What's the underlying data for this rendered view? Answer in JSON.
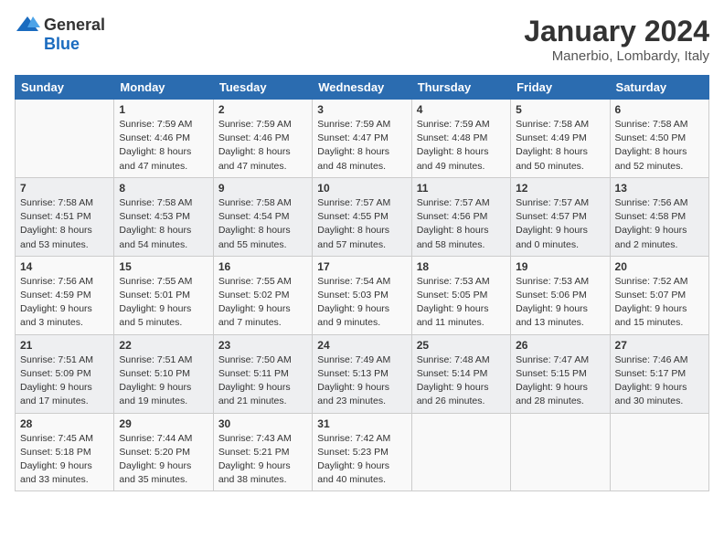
{
  "header": {
    "logo_general": "General",
    "logo_blue": "Blue",
    "title": "January 2024",
    "subtitle": "Manerbio, Lombardy, Italy"
  },
  "days_of_week": [
    "Sunday",
    "Monday",
    "Tuesday",
    "Wednesday",
    "Thursday",
    "Friday",
    "Saturday"
  ],
  "weeks": [
    [
      {
        "day": "",
        "lines": []
      },
      {
        "day": "1",
        "lines": [
          "Sunrise: 7:59 AM",
          "Sunset: 4:46 PM",
          "Daylight: 8 hours",
          "and 47 minutes."
        ]
      },
      {
        "day": "2",
        "lines": [
          "Sunrise: 7:59 AM",
          "Sunset: 4:46 PM",
          "Daylight: 8 hours",
          "and 47 minutes."
        ]
      },
      {
        "day": "3",
        "lines": [
          "Sunrise: 7:59 AM",
          "Sunset: 4:47 PM",
          "Daylight: 8 hours",
          "and 48 minutes."
        ]
      },
      {
        "day": "4",
        "lines": [
          "Sunrise: 7:59 AM",
          "Sunset: 4:48 PM",
          "Daylight: 8 hours",
          "and 49 minutes."
        ]
      },
      {
        "day": "5",
        "lines": [
          "Sunrise: 7:58 AM",
          "Sunset: 4:49 PM",
          "Daylight: 8 hours",
          "and 50 minutes."
        ]
      },
      {
        "day": "6",
        "lines": [
          "Sunrise: 7:58 AM",
          "Sunset: 4:50 PM",
          "Daylight: 8 hours",
          "and 52 minutes."
        ]
      }
    ],
    [
      {
        "day": "7",
        "lines": [
          "Sunrise: 7:58 AM",
          "Sunset: 4:51 PM",
          "Daylight: 8 hours",
          "and 53 minutes."
        ]
      },
      {
        "day": "8",
        "lines": [
          "Sunrise: 7:58 AM",
          "Sunset: 4:53 PM",
          "Daylight: 8 hours",
          "and 54 minutes."
        ]
      },
      {
        "day": "9",
        "lines": [
          "Sunrise: 7:58 AM",
          "Sunset: 4:54 PM",
          "Daylight: 8 hours",
          "and 55 minutes."
        ]
      },
      {
        "day": "10",
        "lines": [
          "Sunrise: 7:57 AM",
          "Sunset: 4:55 PM",
          "Daylight: 8 hours",
          "and 57 minutes."
        ]
      },
      {
        "day": "11",
        "lines": [
          "Sunrise: 7:57 AM",
          "Sunset: 4:56 PM",
          "Daylight: 8 hours",
          "and 58 minutes."
        ]
      },
      {
        "day": "12",
        "lines": [
          "Sunrise: 7:57 AM",
          "Sunset: 4:57 PM",
          "Daylight: 9 hours",
          "and 0 minutes."
        ]
      },
      {
        "day": "13",
        "lines": [
          "Sunrise: 7:56 AM",
          "Sunset: 4:58 PM",
          "Daylight: 9 hours",
          "and 2 minutes."
        ]
      }
    ],
    [
      {
        "day": "14",
        "lines": [
          "Sunrise: 7:56 AM",
          "Sunset: 4:59 PM",
          "Daylight: 9 hours",
          "and 3 minutes."
        ]
      },
      {
        "day": "15",
        "lines": [
          "Sunrise: 7:55 AM",
          "Sunset: 5:01 PM",
          "Daylight: 9 hours",
          "and 5 minutes."
        ]
      },
      {
        "day": "16",
        "lines": [
          "Sunrise: 7:55 AM",
          "Sunset: 5:02 PM",
          "Daylight: 9 hours",
          "and 7 minutes."
        ]
      },
      {
        "day": "17",
        "lines": [
          "Sunrise: 7:54 AM",
          "Sunset: 5:03 PM",
          "Daylight: 9 hours",
          "and 9 minutes."
        ]
      },
      {
        "day": "18",
        "lines": [
          "Sunrise: 7:53 AM",
          "Sunset: 5:05 PM",
          "Daylight: 9 hours",
          "and 11 minutes."
        ]
      },
      {
        "day": "19",
        "lines": [
          "Sunrise: 7:53 AM",
          "Sunset: 5:06 PM",
          "Daylight: 9 hours",
          "and 13 minutes."
        ]
      },
      {
        "day": "20",
        "lines": [
          "Sunrise: 7:52 AM",
          "Sunset: 5:07 PM",
          "Daylight: 9 hours",
          "and 15 minutes."
        ]
      }
    ],
    [
      {
        "day": "21",
        "lines": [
          "Sunrise: 7:51 AM",
          "Sunset: 5:09 PM",
          "Daylight: 9 hours",
          "and 17 minutes."
        ]
      },
      {
        "day": "22",
        "lines": [
          "Sunrise: 7:51 AM",
          "Sunset: 5:10 PM",
          "Daylight: 9 hours",
          "and 19 minutes."
        ]
      },
      {
        "day": "23",
        "lines": [
          "Sunrise: 7:50 AM",
          "Sunset: 5:11 PM",
          "Daylight: 9 hours",
          "and 21 minutes."
        ]
      },
      {
        "day": "24",
        "lines": [
          "Sunrise: 7:49 AM",
          "Sunset: 5:13 PM",
          "Daylight: 9 hours",
          "and 23 minutes."
        ]
      },
      {
        "day": "25",
        "lines": [
          "Sunrise: 7:48 AM",
          "Sunset: 5:14 PM",
          "Daylight: 9 hours",
          "and 26 minutes."
        ]
      },
      {
        "day": "26",
        "lines": [
          "Sunrise: 7:47 AM",
          "Sunset: 5:15 PM",
          "Daylight: 9 hours",
          "and 28 minutes."
        ]
      },
      {
        "day": "27",
        "lines": [
          "Sunrise: 7:46 AM",
          "Sunset: 5:17 PM",
          "Daylight: 9 hours",
          "and 30 minutes."
        ]
      }
    ],
    [
      {
        "day": "28",
        "lines": [
          "Sunrise: 7:45 AM",
          "Sunset: 5:18 PM",
          "Daylight: 9 hours",
          "and 33 minutes."
        ]
      },
      {
        "day": "29",
        "lines": [
          "Sunrise: 7:44 AM",
          "Sunset: 5:20 PM",
          "Daylight: 9 hours",
          "and 35 minutes."
        ]
      },
      {
        "day": "30",
        "lines": [
          "Sunrise: 7:43 AM",
          "Sunset: 5:21 PM",
          "Daylight: 9 hours",
          "and 38 minutes."
        ]
      },
      {
        "day": "31",
        "lines": [
          "Sunrise: 7:42 AM",
          "Sunset: 5:23 PM",
          "Daylight: 9 hours",
          "and 40 minutes."
        ]
      },
      {
        "day": "",
        "lines": []
      },
      {
        "day": "",
        "lines": []
      },
      {
        "day": "",
        "lines": []
      }
    ]
  ]
}
